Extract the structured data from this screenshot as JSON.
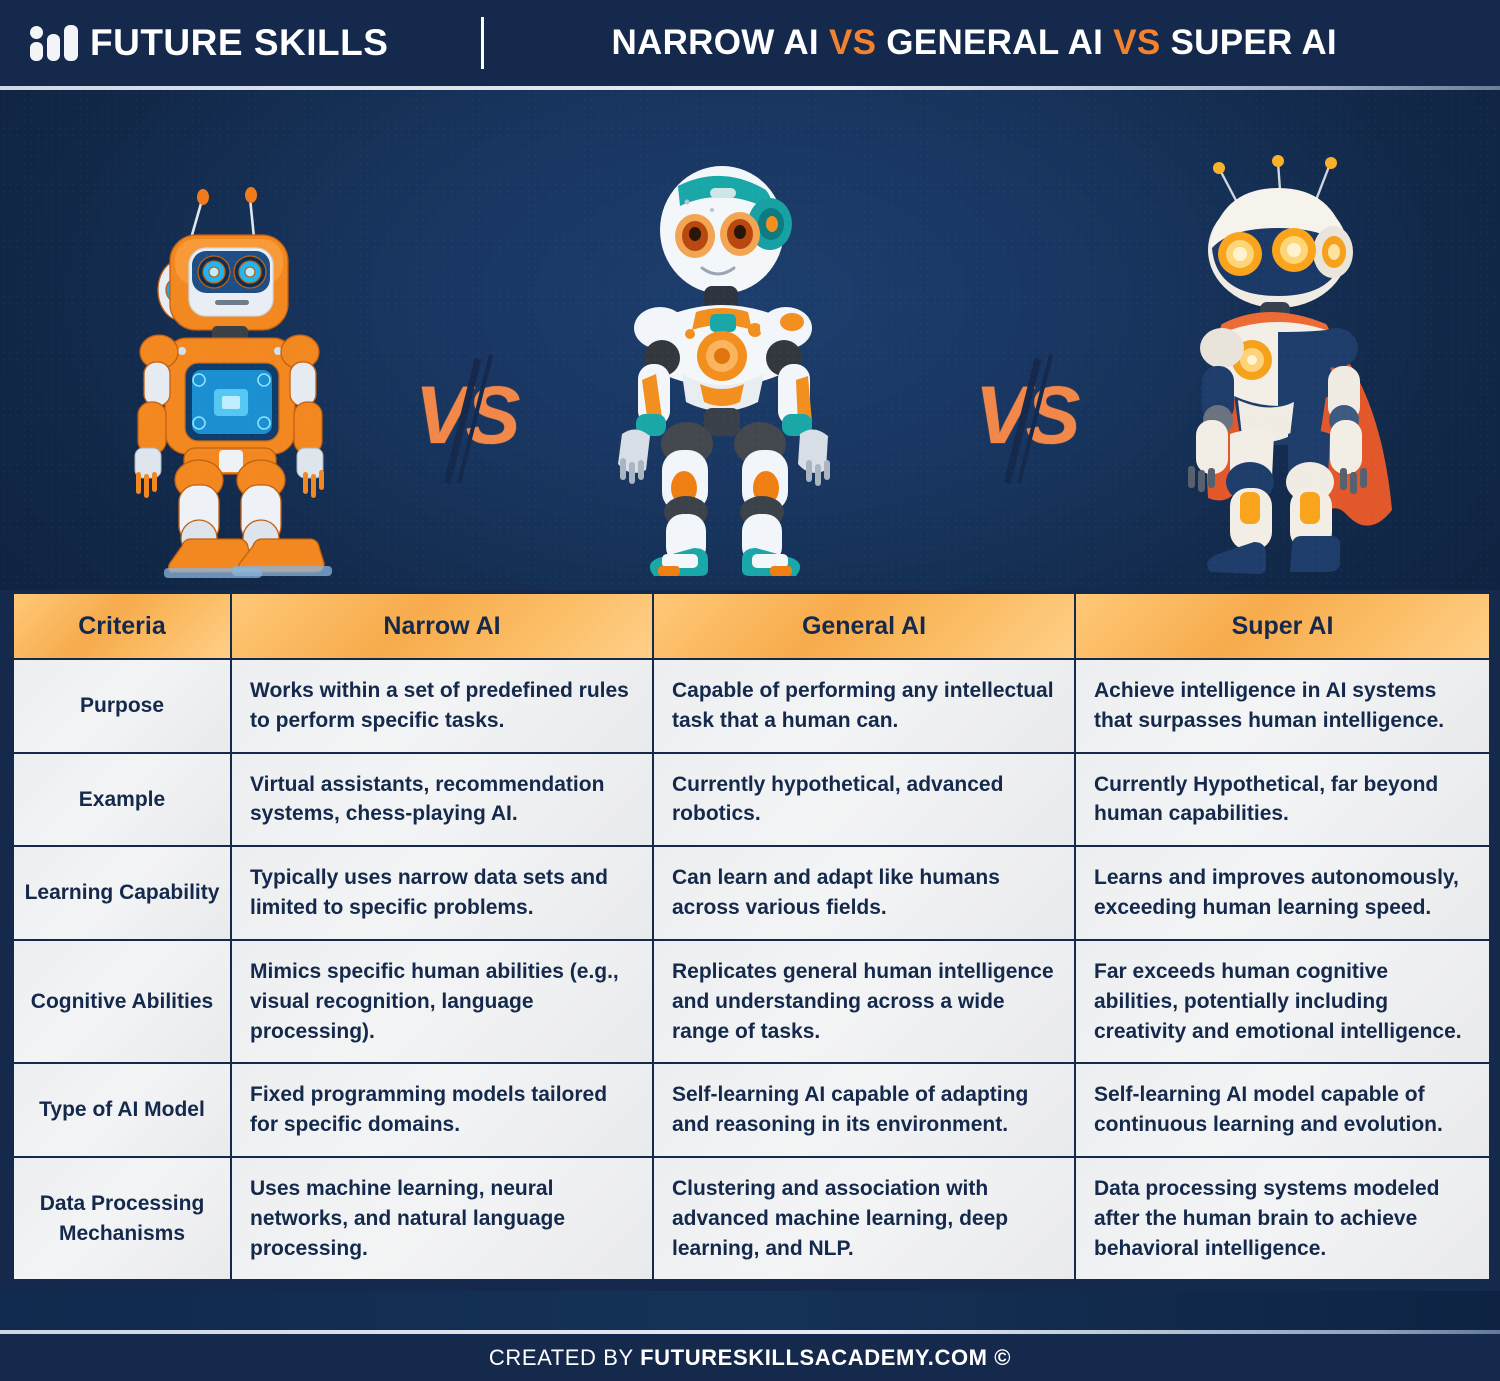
{
  "header": {
    "brand": "FUTURE SKILLS",
    "brand_icon": "bar-chart-logo-icon",
    "title_part1": "NARROW AI ",
    "title_vs1": "VS",
    "title_part2": " GENERAL AI ",
    "title_vs2": "VS",
    "title_part3": " SUPER AI"
  },
  "hero": {
    "robots": [
      {
        "name": "narrow-ai-robot",
        "alt": "orange boxy robot with blue screen chest"
      },
      {
        "name": "general-ai-robot",
        "alt": "white humanoid robot with teal and orange accents"
      },
      {
        "name": "super-ai-robot",
        "alt": "navy and white robot with orange cape and glowing eyes"
      }
    ],
    "vs_label": "VS"
  },
  "table": {
    "headers": [
      "Criteria",
      "Narrow AI",
      "General AI",
      "Super AI"
    ],
    "rows": [
      {
        "criteria": "Purpose",
        "narrow": "Works within a set of predefined rules to perform specific tasks.",
        "general": "Capable of performing any intellectual task that a human can.",
        "super": "Achieve intelligence in AI systems that surpasses human intelligence."
      },
      {
        "criteria": "Example",
        "narrow": "Virtual assistants, recommendation systems, chess-playing AI.",
        "general": "Currently hypothetical, advanced robotics.",
        "super": "Currently Hypothetical, far beyond human capabilities."
      },
      {
        "criteria": "Learning Capability",
        "narrow": "Typically uses narrow data sets and limited to specific problems.",
        "general": "Can learn and adapt like humans across various fields.",
        "super": "Learns and improves autonomously, exceeding human learning speed."
      },
      {
        "criteria": "Cognitive Abilities",
        "narrow": "Mimics specific human abilities (e.g., visual recognition, language processing).",
        "general": "Replicates general human intelligence and understanding across a wide range of tasks.",
        "super": "Far exceeds human cognitive abilities, potentially including creativity and emotional intelligence."
      },
      {
        "criteria": "Type of AI Model",
        "narrow": "Fixed programming models tailored for specific domains.",
        "general": "Self-learning AI capable of adapting and reasoning in its environment.",
        "super": "Self-learning AI model capable of continuous learning and evolution."
      },
      {
        "criteria": "Data Processing Mechanisms",
        "narrow": "Uses machine learning, neural networks, and natural language processing.",
        "general": "Clustering and association with advanced machine learning, deep learning, and NLP.",
        "super": "Data processing systems modeled after the human brain to achieve behavioral intelligence."
      }
    ]
  },
  "footer": {
    "prefix": "CREATED BY ",
    "site": "FUTURESKILLSACADEMY.COM ©"
  },
  "colors": {
    "navy": "#14294b",
    "orange": "#f2822f",
    "header_orange_light": "#ffcf88",
    "header_orange_dark": "#f7ab4c",
    "cell_gray": "#eceef0",
    "white": "#ffffff"
  }
}
